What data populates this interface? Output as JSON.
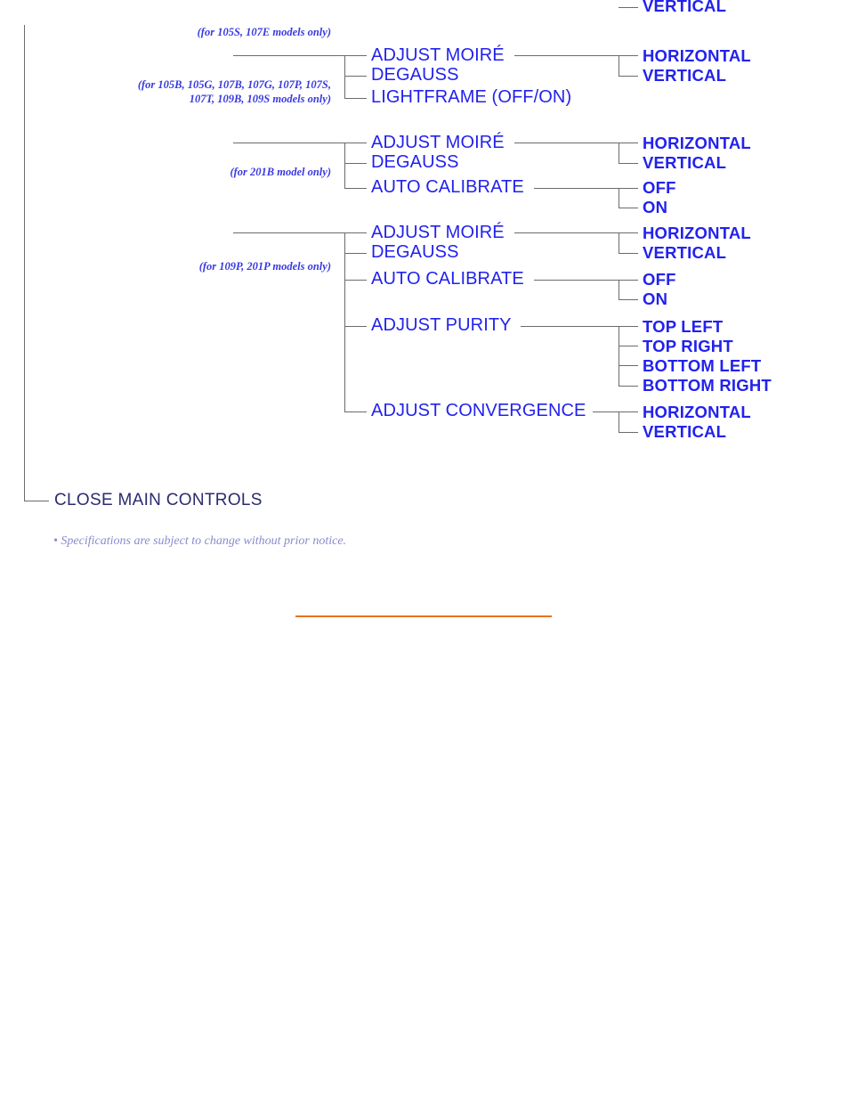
{
  "document": {
    "title": "Monitor OSD Main Controls Tree",
    "background_color": "#ffffff",
    "line_color": "#6b6b6b",
    "accent_color": "#2222ee",
    "close_color": "#2b2b6e",
    "note_color": "#8a8ad0",
    "rule_color": "#e8730d"
  },
  "model_notes": {
    "group0": "(for 105S, 107E models only)",
    "group1": "(for 105B, 105G, 107B, 107G, 107P, 107S, 107T, 109B, 109S models only)",
    "group2": "(for 201B model only)",
    "group3": "(for 109P, 201P models only)"
  },
  "groups": [
    {
      "id": "group0",
      "note": "(for 105S, 107E models only)",
      "branches": [
        {
          "label": "VERTICAL",
          "leaves": []
        }
      ]
    },
    {
      "id": "group1",
      "note": "(for 105B, 105G, 107B, 107G, 107P, 107S, 107T, 109B, 109S models only)",
      "branches": [
        {
          "label": "ADJUST MOIRÉ",
          "leaves": [
            "HORIZONTAL",
            "VERTICAL"
          ]
        },
        {
          "label": "DEGAUSS",
          "leaves": []
        },
        {
          "label": "LIGHTFRAME (OFF/ON)",
          "leaves": []
        }
      ]
    },
    {
      "id": "group2",
      "note": "(for 201B model only)",
      "branches": [
        {
          "label": "ADJUST MOIRÉ",
          "leaves": [
            "HORIZONTAL",
            "VERTICAL"
          ]
        },
        {
          "label": "DEGAUSS",
          "leaves": []
        },
        {
          "label": "AUTO CALIBRATE",
          "leaves": [
            "OFF",
            "ON"
          ]
        }
      ]
    },
    {
      "id": "group3",
      "note": "(for 109P, 201P models only)",
      "branches": [
        {
          "label": "ADJUST MOIRÉ",
          "leaves": [
            "HORIZONTAL",
            "VERTICAL"
          ]
        },
        {
          "label": "DEGAUSS",
          "leaves": []
        },
        {
          "label": "AUTO CALIBRATE",
          "leaves": [
            "OFF",
            "ON"
          ]
        },
        {
          "label": "ADJUST PURITY",
          "leaves": [
            "TOP LEFT",
            "TOP RIGHT",
            "BOTTOM LEFT",
            "BOTTOM RIGHT"
          ]
        },
        {
          "label": "ADJUST CONVERGENCE",
          "leaves": [
            "HORIZONTAL",
            "VERTICAL"
          ]
        }
      ]
    }
  ],
  "labels": {
    "g0_vertical": "VERTICAL",
    "g1_moire": "ADJUST MOIRÉ",
    "g1_degauss": "DEGAUSS",
    "g1_lightframe": "LIGHTFRAME (OFF/ON)",
    "g1_horizontal": "HORIZONTAL",
    "g1_vertical": "VERTICAL",
    "g2_moire": "ADJUST MOIRÉ",
    "g2_degauss": "DEGAUSS",
    "g2_autocal": "AUTO CALIBRATE",
    "g2_horizontal": "HORIZONTAL",
    "g2_vertical": "VERTICAL",
    "g2_off": "OFF",
    "g2_on": "ON",
    "g3_moire": "ADJUST MOIRÉ",
    "g3_degauss": "DEGAUSS",
    "g3_autocal": "AUTO CALIBRATE",
    "g3_purity": "ADJUST PURITY",
    "g3_convergence": "ADJUST CONVERGENCE",
    "g3_horizontal": "HORIZONTAL",
    "g3_vertical": "VERTICAL",
    "g3_off": "OFF",
    "g3_on": "ON",
    "g3_topleft": "TOP LEFT",
    "g3_topright": "TOP RIGHT",
    "g3_bottomleft": "BOTTOM LEFT",
    "g3_bottomright": "BOTTOM RIGHT",
    "g3_conv_horizontal": "HORIZONTAL",
    "g3_conv_vertical": "VERTICAL"
  },
  "close_main_controls": "CLOSE MAIN CONTROLS",
  "footnote": "• Specifications are subject to change without prior notice."
}
